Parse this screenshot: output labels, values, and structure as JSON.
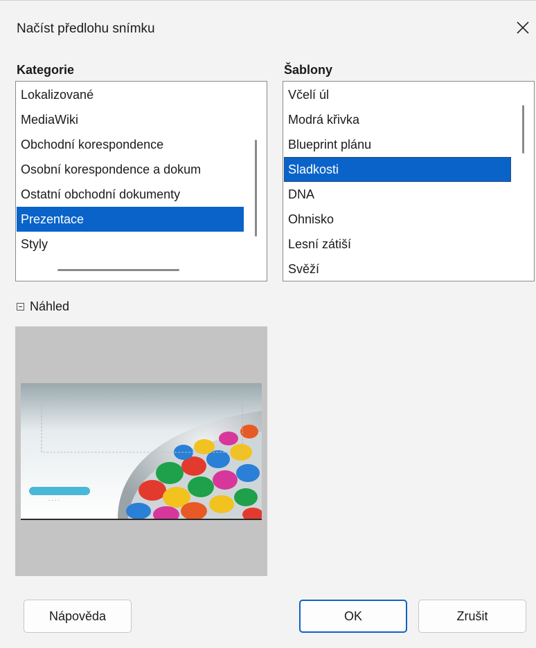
{
  "window": {
    "title": "Načíst předlohu snímku",
    "close_icon": "close-icon"
  },
  "categories": {
    "label": "Kategorie",
    "items": [
      "Lokalizované",
      "MediaWiki",
      "Obchodní korespondence",
      "Osobní korespondence a dokum",
      "Ostatní obchodní dokumenty",
      "Prezentace",
      "Styly"
    ],
    "selected": "Prezentace"
  },
  "templates": {
    "label": "Šablony",
    "items": [
      "Včelí úl",
      "Modrá křivka",
      "Blueprint plánu",
      "Sladkosti",
      "DNA",
      "Ohnisko",
      "Lesní zátiší",
      "Svěží"
    ],
    "selected": "Sladkosti"
  },
  "preview": {
    "toggle_label": "Náhled",
    "toggle_icon": "collapse-minus-icon",
    "expanded": true
  },
  "buttons": {
    "help": "Nápověda",
    "ok": "OK",
    "cancel": "Zrušit"
  },
  "colors": {
    "selection": "#0a63c9",
    "dialog_bg": "#f3f3f3",
    "preview_bg": "#c4c4c4"
  }
}
